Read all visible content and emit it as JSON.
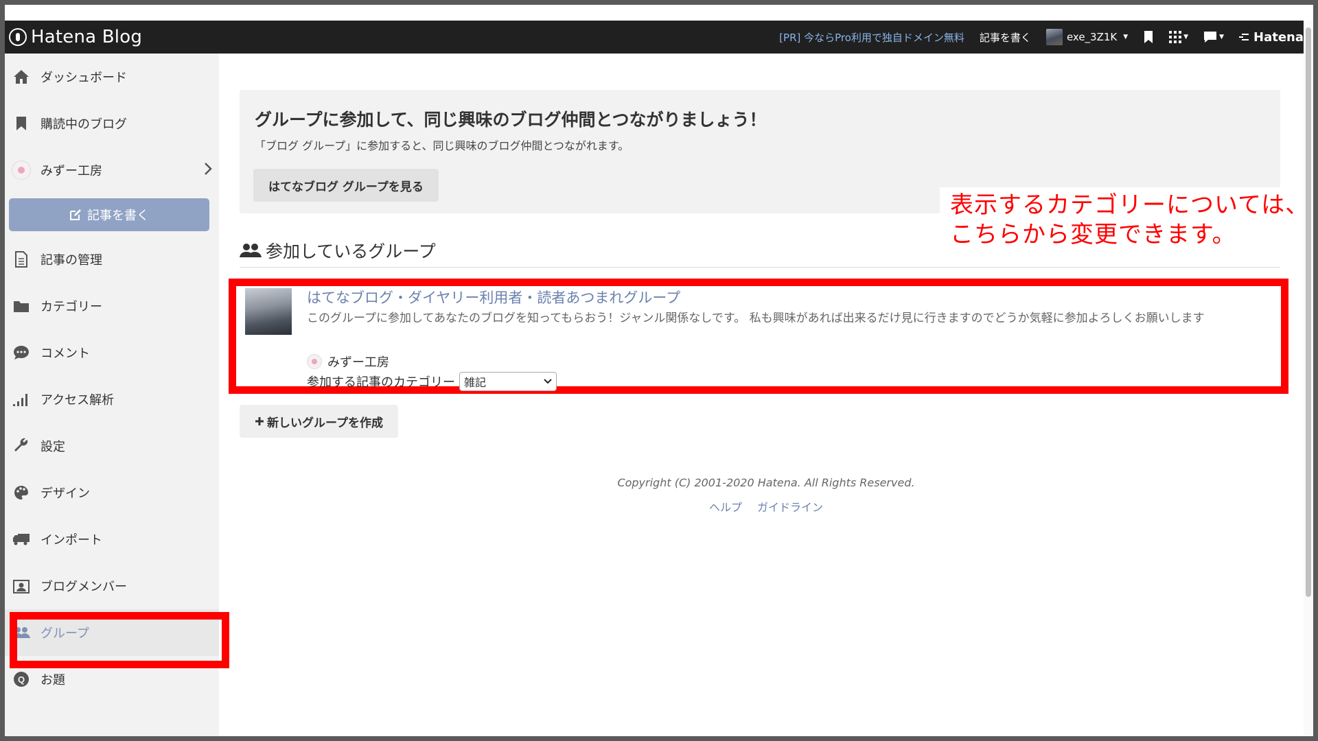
{
  "topbar": {
    "brand": "Hatena Blog",
    "pr_link": "[PR] 今ならPro利用で独自ドメイン無料",
    "write": "記事を書く",
    "username": "exe_3Z1K",
    "hatena": "Hatena"
  },
  "sidebar": {
    "items": [
      {
        "label": "ダッシュボード",
        "icon": "home-icon"
      },
      {
        "label": "購読中のブログ",
        "icon": "bookmark-icon"
      },
      {
        "label": "みずー工房",
        "icon": "blog-avatar"
      },
      {
        "label": "記事の管理",
        "icon": "document-icon"
      },
      {
        "label": "カテゴリー",
        "icon": "folder-icon"
      },
      {
        "label": "コメント",
        "icon": "comment-icon"
      },
      {
        "label": "アクセス解析",
        "icon": "chart-icon"
      },
      {
        "label": "設定",
        "icon": "wrench-icon"
      },
      {
        "label": "デザイン",
        "icon": "palette-icon"
      },
      {
        "label": "インポート",
        "icon": "truck-icon"
      },
      {
        "label": "ブログメンバー",
        "icon": "member-icon"
      },
      {
        "label": "グループ",
        "icon": "group-icon"
      },
      {
        "label": "お題",
        "icon": "odai-icon"
      }
    ],
    "write_button": "記事を書く"
  },
  "promo": {
    "title": "グループに参加して、同じ興味のブログ仲間とつながりましょう！",
    "subtitle": "「ブログ グループ」に参加すると、同じ興味のブログ仲間とつながれます。",
    "button": "はてなブログ グループを見る"
  },
  "annotation": {
    "line1": "表示するカテゴリーについては、",
    "line2": "こちらから変更できます。"
  },
  "groups": {
    "heading": "参加しているグループ",
    "item": {
      "title": "はてなブログ・ダイヤリー利用者・読者あつまれグループ",
      "description": "このグループに参加してあなたのブログを知ってもらおう！ジャンル関係なしです。 私も興味があれば出来るだけ見に行きますのでどうか気軽に参加よろしくお願いします",
      "owner": "みずー工房",
      "category_label": "参加する記事のカテゴリー",
      "category_value": "雑記"
    },
    "new_group_button": "新しいグループを作成"
  },
  "footer": {
    "copyright": "Copyright (C) 2001-2020 Hatena. All Rights Reserved.",
    "links": [
      "ヘルプ",
      "ガイドライン"
    ]
  },
  "colors": {
    "topbar": "#202020",
    "accent": "#7d91b6",
    "link": "#6b82ad",
    "annotation": "#ff0000"
  }
}
